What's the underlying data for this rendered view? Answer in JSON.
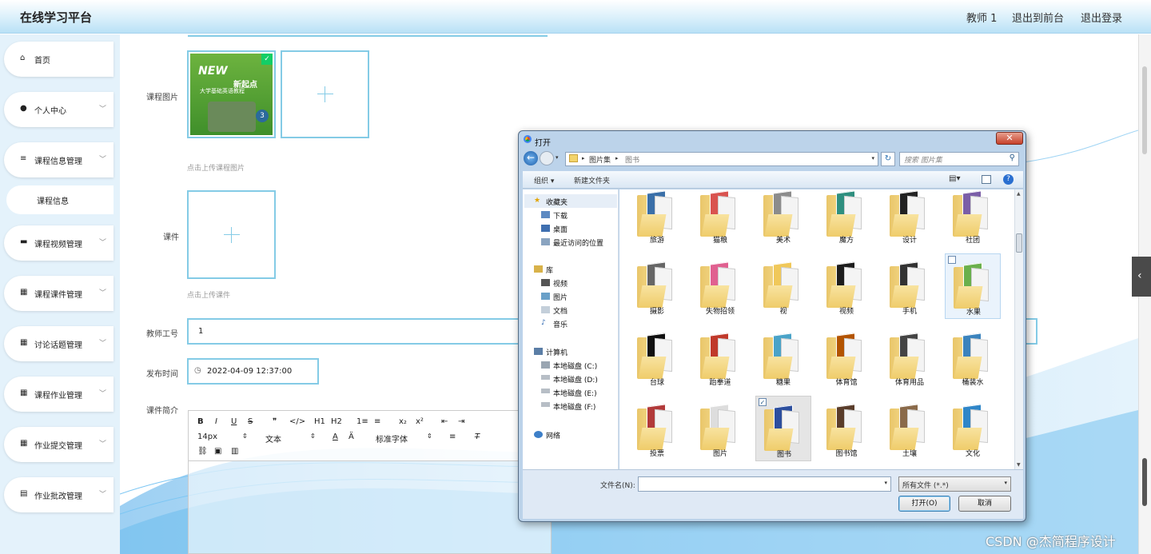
{
  "app": {
    "title": "在线学习平台"
  },
  "topbar": {
    "user": "教师 1",
    "front_link": "退出到前台",
    "logout_link": "退出登录"
  },
  "sidebar": {
    "items": [
      {
        "label": "首页",
        "icon": "home-icon"
      },
      {
        "label": "个人中心",
        "icon": "user-icon"
      },
      {
        "label": "课程信息管理",
        "icon": "list-icon"
      },
      {
        "label": "课程视频管理",
        "icon": "video-icon"
      },
      {
        "label": "课程课件管理",
        "icon": "grid-icon"
      },
      {
        "label": "讨论话题管理",
        "icon": "grid-icon"
      },
      {
        "label": "课程作业管理",
        "icon": "grid-icon"
      },
      {
        "label": "作业提交管理",
        "icon": "grid-icon"
      },
      {
        "label": "作业批改管理",
        "icon": "clipboard-icon"
      }
    ],
    "sub_item": "课程信息"
  },
  "form": {
    "image_label": "课程图片",
    "image_hint": "点击上传课程图片",
    "courseware_label": "课件",
    "courseware_hint": "点击上传课件",
    "teacher_id_label": "教师工号",
    "teacher_id_value": "1",
    "publish_time_label": "发布时间",
    "publish_time_value": "2022-04-09 12:37:00",
    "intro_label": "课件简介",
    "book_cover_text": {
      "brand": "NEW",
      "title": "新起点",
      "subtitle": "大学基础英语教程",
      "volume": "3"
    }
  },
  "editor": {
    "font_size": "14px",
    "block_type": "文本",
    "font_family": "标准字体",
    "buttons": [
      "B",
      "I",
      "U",
      "S",
      "❞",
      "</>",
      "H1",
      "H2",
      "1≡",
      "≡",
      "x₂",
      "x²",
      "⇤",
      "⇥"
    ]
  },
  "dialog": {
    "title": "打开",
    "breadcrumb": [
      "图片集",
      "图书"
    ],
    "search_placeholder": "搜索 图片集",
    "organize": "组织 ▾",
    "new_folder": "新建文件夹",
    "nav": {
      "favorites": "收藏夹",
      "fav_items": [
        "下载",
        "桌面",
        "最近访问的位置"
      ],
      "library": "库",
      "lib_items": [
        "视频",
        "图片",
        "文档",
        "音乐"
      ],
      "computer": "计算机",
      "drives": [
        "本地磁盘 (C:)",
        "本地磁盘 (D:)",
        "本地磁盘 (E:)",
        "本地磁盘 (F:)"
      ],
      "network": "网络"
    },
    "folders": [
      "旅游",
      "猫粮",
      "美术",
      "魔方",
      "设计",
      "社团",
      "摄影",
      "失物招领",
      "视",
      "视频",
      "手机",
      "水果",
      "台球",
      "跆拳道",
      "糖果",
      "体育馆",
      "体育用品",
      "桶装水",
      "投票",
      "图片",
      "图书",
      "图书馆",
      "土壤",
      "文化"
    ],
    "selected_folder": "图书",
    "hover_folder": "水果",
    "filename_label": "文件名(N):",
    "filename_value": "",
    "filetype": "所有文件 (*.*)",
    "open_button": "打开(O)",
    "cancel_button": "取消"
  },
  "watermark": "CSDN @杰简程序设计",
  "colors": {
    "accent": "#84cbe6",
    "sidebar_bg": "#e4f2fb",
    "dialog_frame": "#bcd3ea"
  }
}
